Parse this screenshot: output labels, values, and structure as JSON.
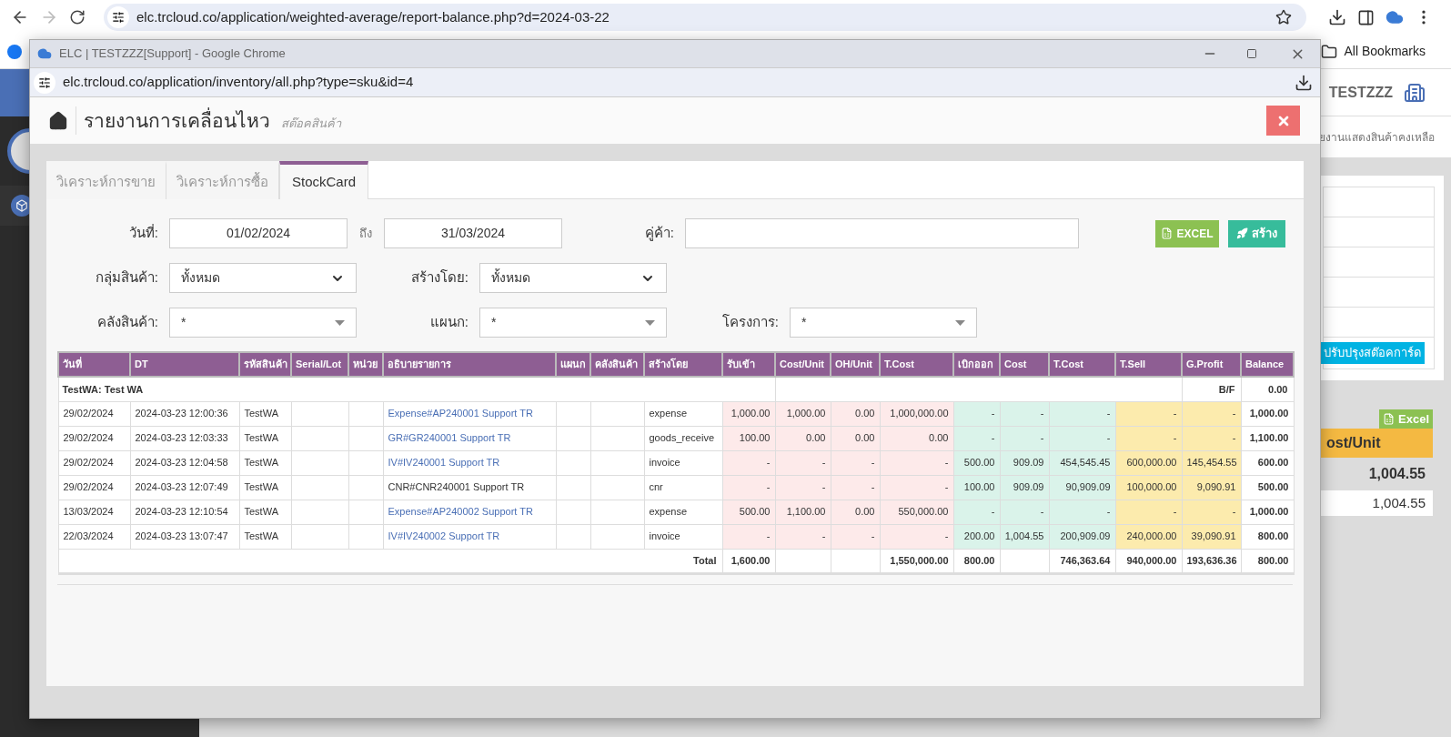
{
  "browser": {
    "url": "elc.trcloud.co/application/weighted-average/report-balance.php?d=2024-03-22",
    "bookmarks": "All Bookmarks"
  },
  "background_page": {
    "company": "TESTZZZ",
    "subtitle": "ยงานแสดงสินค้าคงเหลือ",
    "adjust_button": "ปรับปรุงสต๊อคการ์ด",
    "excel_button": "Excel",
    "column_header": "ost/Unit",
    "values": [
      "1,004.55",
      "1,004.55"
    ]
  },
  "popup": {
    "title": "ELC | TESTZZZ[Support] - Google Chrome",
    "url": "elc.trcloud.co/application/inventory/all.php?type=sku&id=4"
  },
  "page": {
    "title": "รายงานการเคลื่อนไหว",
    "subtitle": "สต๊อคสินค้า"
  },
  "tabs": [
    {
      "label": "วิเคราะห์การขาย",
      "selected": false
    },
    {
      "label": "วิเคราะห์การซื้อ",
      "selected": false
    },
    {
      "label": "StockCard",
      "selected": true
    }
  ],
  "form": {
    "date_label": "วันที่:",
    "date_from": "01/02/2024",
    "to_label": "ถึง",
    "date_to": "31/03/2024",
    "partner_label": "คู่ค้า:",
    "excel_button": "EXCEL",
    "create_button": "สร้าง",
    "group_label": "กลุ่มสินค้า:",
    "group_value": "ทั้งหมด",
    "created_by_label": "สร้างโดย:",
    "created_by_value": "ทั้งหมด",
    "warehouse_label": "คลังสินค้า:",
    "warehouse_value": "*",
    "department_label": "แผนก:",
    "department_value": "*",
    "project_label": "โครงการ:",
    "project_value": "*"
  },
  "table": {
    "columns": [
      "วันที่",
      "DT",
      "รหัสสินค้า",
      "Serial/Lot",
      "หน่วย",
      "อธิบายรายการ",
      "แผนก",
      "คลังสินค้า",
      "สร้างโดย",
      "รับเข้า",
      "Cost/Unit",
      "OH/Unit",
      "T.Cost",
      "เบิกออก",
      "Cost",
      "T.Cost",
      "T.Sell",
      "G.Profit",
      "Balance"
    ],
    "group": {
      "label": "TestWA: Test WA",
      "bf_label": "B/F",
      "bf_balance": "0.00"
    },
    "rows": [
      {
        "date": "29/02/2024",
        "dt": "2024-03-23 12:00:36",
        "sku": "TestWA",
        "description": "Expense#AP240001 Support TR",
        "link": true,
        "created_by": "expense",
        "in_qty": "1,000.00",
        "in_cost": "1,000.00",
        "oh": "0.00",
        "in_total": "1,000,000.00",
        "out_qty": "-",
        "out_cost": "-",
        "out_total": "-",
        "sell": "-",
        "profit": "-",
        "balance": "1,000.00"
      },
      {
        "date": "29/02/2024",
        "dt": "2024-03-23 12:03:33",
        "sku": "TestWA",
        "description": "GR#GR240001 Support TR",
        "link": true,
        "created_by": "goods_receive",
        "in_qty": "100.00",
        "in_cost": "0.00",
        "oh": "0.00",
        "in_total": "0.00",
        "out_qty": "-",
        "out_cost": "-",
        "out_total": "-",
        "sell": "-",
        "profit": "-",
        "balance": "1,100.00"
      },
      {
        "date": "29/02/2024",
        "dt": "2024-03-23 12:04:58",
        "sku": "TestWA",
        "description": "IV#IV240001 Support TR",
        "link": true,
        "created_by": "invoice",
        "in_qty": "-",
        "in_cost": "-",
        "oh": "-",
        "in_total": "-",
        "out_qty": "500.00",
        "out_cost": "909.09",
        "out_total": "454,545.45",
        "sell": "600,000.00",
        "profit": "145,454.55",
        "balance": "600.00"
      },
      {
        "date": "29/02/2024",
        "dt": "2024-03-23 12:07:49",
        "sku": "TestWA",
        "description": "CNR#CNR240001 Support TR",
        "link": false,
        "created_by": "cnr",
        "in_qty": "-",
        "in_cost": "-",
        "oh": "-",
        "in_total": "-",
        "out_qty": "100.00",
        "out_cost": "909.09",
        "out_total": "90,909.09",
        "sell": "100,000.00",
        "profit": "9,090.91",
        "balance": "500.00"
      },
      {
        "date": "13/03/2024",
        "dt": "2024-03-23 12:10:54",
        "sku": "TestWA",
        "description": "Expense#AP240002 Support TR",
        "link": true,
        "created_by": "expense",
        "in_qty": "500.00",
        "in_cost": "1,100.00",
        "oh": "0.00",
        "in_total": "550,000.00",
        "out_qty": "-",
        "out_cost": "-",
        "out_total": "-",
        "sell": "-",
        "profit": "-",
        "balance": "1,000.00"
      },
      {
        "date": "22/03/2024",
        "dt": "2024-03-23 13:07:47",
        "sku": "TestWA",
        "description": "IV#IV240002 Support TR",
        "link": true,
        "created_by": "invoice",
        "in_qty": "-",
        "in_cost": "-",
        "oh": "-",
        "in_total": "-",
        "out_qty": "200.00",
        "out_cost": "1,004.55",
        "out_total": "200,909.09",
        "sell": "240,000.00",
        "profit": "39,090.91",
        "balance": "800.00"
      }
    ],
    "total": {
      "label": "Total",
      "in_qty": "1,600.00",
      "in_total": "1,550,000.00",
      "out_qty": "800.00",
      "out_total": "746,363.64",
      "sell": "940,000.00",
      "profit": "193,636.36",
      "balance": "800.00"
    }
  }
}
